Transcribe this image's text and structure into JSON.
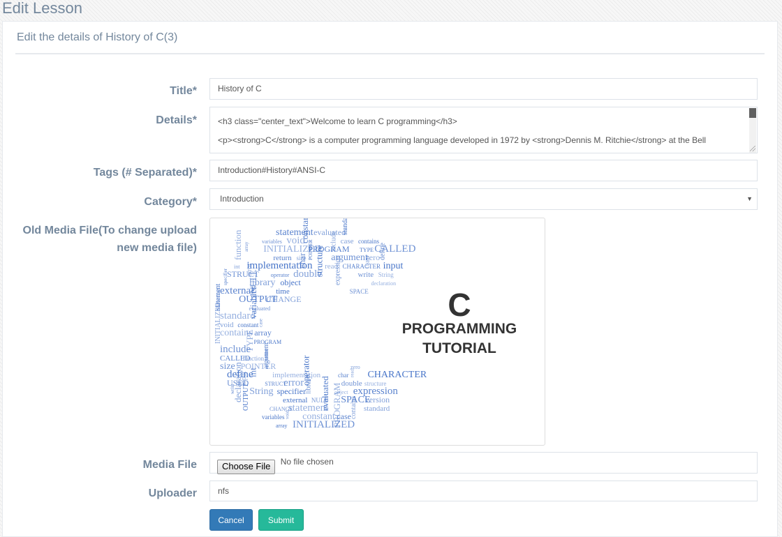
{
  "page": {
    "title": "Edit Lesson"
  },
  "panel": {
    "heading": "Edit the details of History of C(3)"
  },
  "form": {
    "title_label": "Title*",
    "title_value": "History of C",
    "details_label": "Details*",
    "details_lines": [
      "<h3 class=\"center_text\">Welcome to learn C programming</h3>",
      "<p><strong>C</strong> is a computer programming language developed in 1972 by <strong>Dennis M. Ritchie</strong> at the Bell"
    ],
    "tags_label": "Tags (# Separated)*",
    "tags_value": "Introduction#History#ANSI-C",
    "category_label": "Category*",
    "category_value": "Introduction",
    "old_media_label_line1": "Old Media File(To change upload",
    "old_media_label_line2": "new media file)",
    "media_image": {
      "big_letter": "C",
      "caption_line1": "PROGRAMMING",
      "caption_line2": "TUTORIAL",
      "words": [
        "statement",
        "evaluated",
        "standard",
        "variables",
        "void",
        "constant",
        "case",
        "contains",
        "array",
        "INITIALIZED",
        "PROGRAM",
        "include",
        "TYPE",
        "CALLED",
        "function",
        "return",
        "size",
        "POINTER",
        "argument",
        "zero",
        "define",
        "int",
        "implementation",
        "char",
        "read",
        "CHARACTER",
        "USED",
        "input",
        "STRUCT",
        "error",
        "operator",
        "double",
        "structure",
        "write",
        "String",
        "specifier",
        "library",
        "object",
        "expression",
        "declaration",
        "external",
        "NULL",
        "time",
        "SPACE",
        "version",
        "OUTPUT",
        "CHANGE"
      ]
    },
    "media_file_label": "Media File",
    "choose_file_label": "Choose File",
    "no_file_text": "No file chosen",
    "uploader_label": "Uploader",
    "uploader_value": "nfs"
  },
  "buttons": {
    "cancel": "Cancel",
    "submit": "Submit"
  },
  "colors": {
    "primary": "#337ab7",
    "success": "#26b99a",
    "text": "#73879c",
    "word_cloud": "#3f6ec6"
  }
}
